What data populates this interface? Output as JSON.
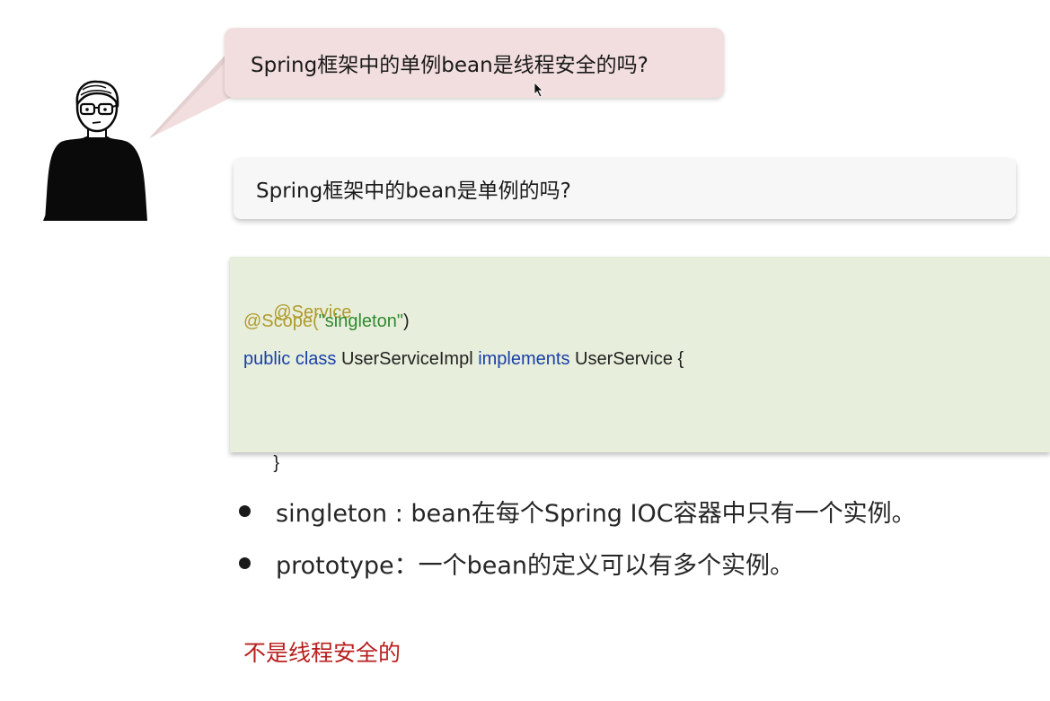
{
  "question": {
    "text": "Spring框架中的单例bean是线程安全的吗?"
  },
  "sub_question": {
    "text": "Spring框架中的bean是单例的吗?"
  },
  "code": {
    "line1_annotation": "@Service",
    "line2_annotation": "@Scope(",
    "line2_string": "\"singleton\"",
    "line2_close": ")",
    "line3_keyword1": "public class",
    "line3_name": " UserServiceImpl ",
    "line3_keyword2": "implements",
    "line3_iface": " UserService {",
    "line5_close": "}"
  },
  "bullets": [
    {
      "text": "singleton : bean在每个Spring IOC容器中只有一个实例。"
    },
    {
      "text": "prototype：一个bean的定义可以有多个实例。"
    }
  ],
  "conclusion": {
    "text": "不是线程安全的"
  },
  "colors": {
    "question_bg": "#f2dede",
    "code_bg": "#e7efdc",
    "annotation": "#b09a2c",
    "string": "#2f8a2f",
    "keyword": "#1a3fa8",
    "conclusion": "#b8201e"
  },
  "icons": {
    "avatar": "person-with-glasses-illustration",
    "cursor": "mouse-pointer-icon"
  }
}
